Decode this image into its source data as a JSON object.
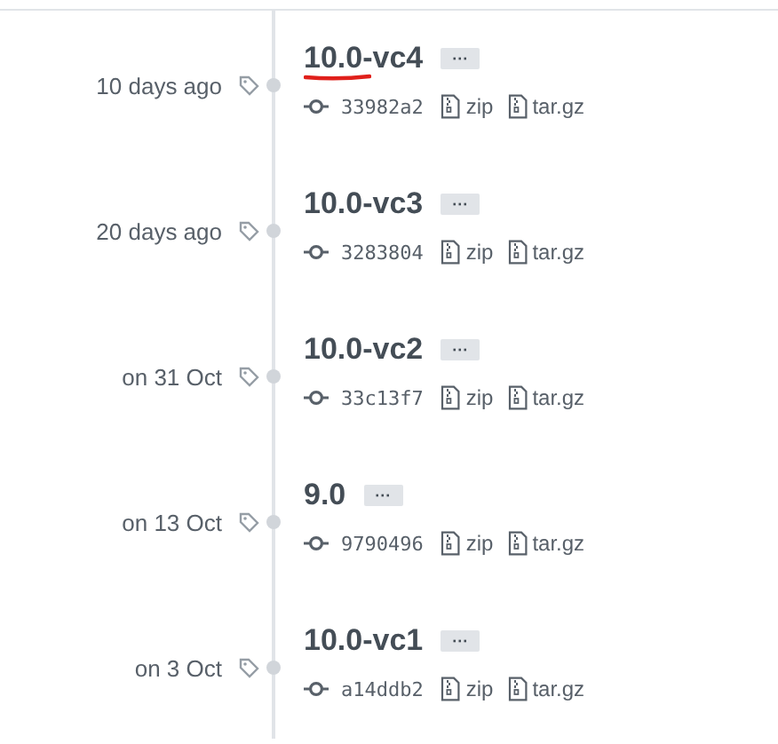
{
  "tags": [
    {
      "date": "10 days ago",
      "name": "10.0-vc4",
      "underlined": true,
      "more": "···",
      "commit": "33982a2",
      "downloads": [
        "zip",
        "tar.gz"
      ]
    },
    {
      "date": "20 days ago",
      "name": "10.0-vc3",
      "underlined": false,
      "more": "···",
      "commit": "3283804",
      "downloads": [
        "zip",
        "tar.gz"
      ]
    },
    {
      "date": "on 31 Oct",
      "name": "10.0-vc2",
      "underlined": false,
      "more": "···",
      "commit": "33c13f7",
      "downloads": [
        "zip",
        "tar.gz"
      ]
    },
    {
      "date": "on 13 Oct",
      "name": "9.0",
      "underlined": false,
      "more": "···",
      "commit": "9790496",
      "downloads": [
        "zip",
        "tar.gz"
      ]
    },
    {
      "date": "on 3 Oct",
      "name": "10.0-vc1",
      "underlined": false,
      "more": "···",
      "commit": "a14ddb2",
      "downloads": [
        "zip",
        "tar.gz"
      ]
    }
  ]
}
